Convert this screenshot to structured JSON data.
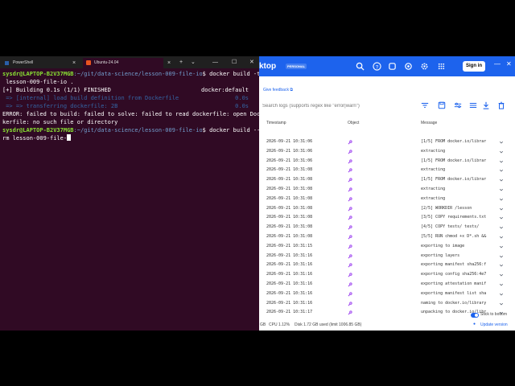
{
  "terminal": {
    "tabs": [
      {
        "label": "PowerShell",
        "close": "×"
      },
      {
        "label": "Ubuntu-24.04",
        "close": "×"
      }
    ],
    "new_tab": "+",
    "dropdown": "⌄",
    "win_min": "—",
    "win_max": "☐",
    "win_close": "✕",
    "lines": {
      "l1_prompt_user": "sysdr@LAPTOP-B2V37MGB",
      "l1_path": ":~/git/data-science/lesson-009-file-io",
      "l1_cmd": "$ docker build -t",
      "l2": " lesson-009-file-io .",
      "l3_left": "[+] Building 0.1s (1/1) FINISHED",
      "l3_right": "docker:default",
      "l4_left": " => [internal] load build definition from Dockerfile",
      "l4_right": "0.0s",
      "l5_left": " => => transferring dockerfile: 2B",
      "l5_right": "0.0s",
      "l6": "ERROR: failed to build: failed to solve: failed to read dockerfile: open Doc",
      "l7": "kerfile: no such file or directory",
      "l8_prompt_user": "sysdr@LAPTOP-B2V37MGB",
      "l8_path": ":~/git/data-science/lesson-009-file-io",
      "l8_cmd": "$ docker build --",
      "l9": "rm lesson-009-file-"
    }
  },
  "docker": {
    "brand": "ktop",
    "badge": "PERSONAL",
    "signin": "Sign in",
    "feedback": "Give feedback",
    "search_placeholder": "Search logs (supports regex like \"error|warn\")",
    "headers": {
      "timestamp": "Timestamp",
      "object": "Object",
      "message": "Message"
    },
    "rows": [
      {
        "ts": "2026-09-21 10:31:06",
        "msg": "[1/5] FROM docker.io/librar"
      },
      {
        "ts": "2026-09-21 10:31:06",
        "msg": "extracting"
      },
      {
        "ts": "2026-09-21 10:31:06",
        "msg": "[1/5] FROM docker.io/librar"
      },
      {
        "ts": "2026-09-21 10:31:08",
        "msg": "extracting"
      },
      {
        "ts": "2026-09-21 10:31:08",
        "msg": "[1/5] FROM docker.io/librar"
      },
      {
        "ts": "2026-09-21 10:31:08",
        "msg": "extracting"
      },
      {
        "ts": "2026-09-21 10:31:08",
        "msg": "extracting"
      },
      {
        "ts": "2026-09-21 10:31:08",
        "msg": "[2/5] WORKDIR /lesson"
      },
      {
        "ts": "2026-09-21 10:31:08",
        "msg": "[3/5] COPY requirements.txt"
      },
      {
        "ts": "2026-09-21 10:31:08",
        "msg": "[4/5] COPY tests/ tests/"
      },
      {
        "ts": "2026-09-21 10:31:08",
        "msg": "[5/5] RUN chmod +x D*.sh &&"
      },
      {
        "ts": "2026-09-21 10:31:15",
        "msg": "exporting to image"
      },
      {
        "ts": "2026-09-21 10:31:16",
        "msg": "exporting layers"
      },
      {
        "ts": "2026-09-21 10:31:16",
        "msg": "exporting manifest sha256:f"
      },
      {
        "ts": "2026-09-21 10:31:16",
        "msg": "exporting config sha256:4e7"
      },
      {
        "ts": "2026-09-21 10:31:16",
        "msg": "exporting attestation manif"
      },
      {
        "ts": "2026-09-21 10:31:16",
        "msg": "exporting manifest list sha"
      },
      {
        "ts": "2026-09-21 10:31:16",
        "msg": "naming to docker.io/library"
      },
      {
        "ts": "2026-09-21 10:31:17",
        "msg": "unpacking to docker.io/libr"
      }
    ],
    "stick_to_bottom": "Stick to bottom",
    "status": {
      "prefix": "GB",
      "cpu": "CPU 1.12%",
      "disk": "Disk 1.72 GB used (limit 1006.85 GB)",
      "update": "Update version"
    },
    "accent": "#1d63ed"
  }
}
